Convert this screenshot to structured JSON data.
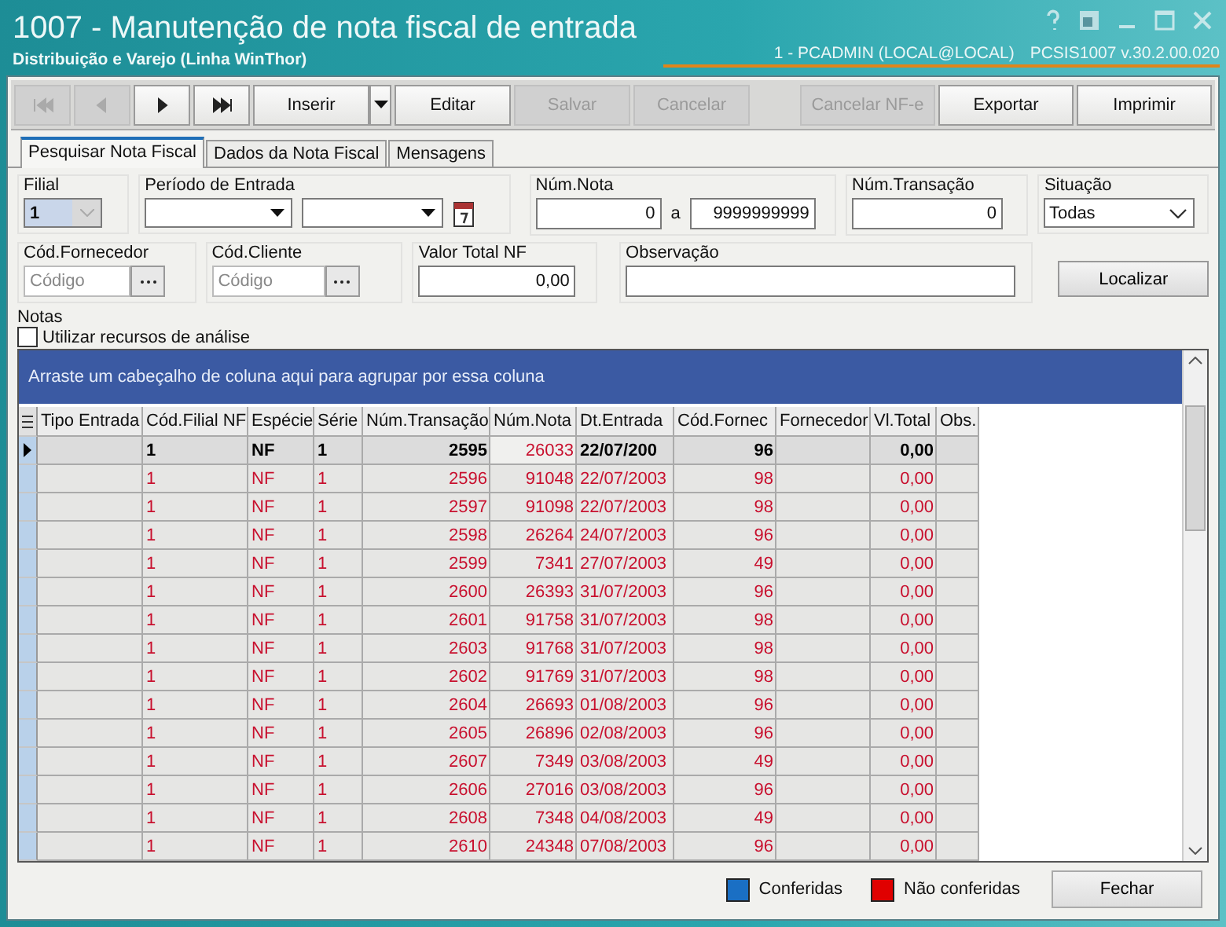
{
  "window": {
    "title": "1007 - Manutenção de nota fiscal de entrada",
    "subtitle": "Distribuição e Varejo (Linha WinThor)",
    "session": "1 - PCADMIN (LOCAL@LOCAL)",
    "version": "PCSIS1007  v.30.2.00.020"
  },
  "toolbar": {
    "nav": [
      {
        "disabled": true
      },
      {
        "disabled": true
      },
      {
        "disabled": false
      },
      {
        "disabled": false
      }
    ],
    "left": [
      {
        "label": "Inserir",
        "kind": "split",
        "disabled": false
      },
      {
        "label": "Editar",
        "kind": "plain",
        "disabled": false
      },
      {
        "label": "Salvar",
        "kind": "plain",
        "disabled": true
      },
      {
        "label": "Cancelar",
        "kind": "plain",
        "disabled": true
      }
    ],
    "right": [
      {
        "label": "Cancelar NF-e",
        "disabled": true
      },
      {
        "label": "Exportar",
        "disabled": false
      },
      {
        "label": "Imprimir",
        "disabled": false
      }
    ]
  },
  "tabs": [
    {
      "label": "Pesquisar Nota Fiscal",
      "selected": true
    },
    {
      "label": "Dados da Nota Fiscal",
      "selected": false
    },
    {
      "label": "Mensagens",
      "selected": false
    }
  ],
  "form": {
    "filial": {
      "label": "Filial",
      "value": "1"
    },
    "periodo": {
      "label": "Período de Entrada"
    },
    "num_nota": {
      "label": "Núm.Nota",
      "from": "0",
      "separator": "a",
      "to": "9999999999"
    },
    "num_transacao": {
      "label": "Núm.Transação",
      "value": "0"
    },
    "situacao": {
      "label": "Situação",
      "value": "Todas"
    },
    "cod_fornecedor": {
      "label": "Cód.Fornecedor",
      "placeholder": "Código"
    },
    "cod_cliente": {
      "label": "Cód.Cliente",
      "placeholder": "Código"
    },
    "valor_total": {
      "label": "Valor Total NF",
      "value": "0,00"
    },
    "observacao": {
      "label": "Observação"
    },
    "localizar": "Localizar"
  },
  "notas": {
    "label": "Notas",
    "checkbox": {
      "label": "Utilizar recursos de análise",
      "checked": false
    }
  },
  "grid": {
    "group_hint": "Arraste um cabeçalho de coluna aqui para agrupar por essa coluna",
    "columns": [
      "Tipo Entrada",
      "Cód.Filial NF",
      "Espécie",
      "Série",
      "Núm.Transação",
      "Núm.Nota",
      "Dt.Entrada",
      "Cód.Fornec",
      "Fornecedor",
      "Vl.Total",
      "Obs."
    ],
    "rows": [
      {
        "selected": true,
        "cells": [
          "",
          "1",
          "NF",
          "1",
          "2595",
          "26033",
          "22/07/200",
          "96",
          "",
          "0,00",
          ""
        ]
      },
      {
        "selected": false,
        "cells": [
          "",
          "1",
          "NF",
          "1",
          "2596",
          "91048",
          "22/07/2003",
          "98",
          "",
          "0,00",
          ""
        ]
      },
      {
        "selected": false,
        "cells": [
          "",
          "1",
          "NF",
          "1",
          "2597",
          "91098",
          "22/07/2003",
          "98",
          "",
          "0,00",
          ""
        ]
      },
      {
        "selected": false,
        "cells": [
          "",
          "1",
          "NF",
          "1",
          "2598",
          "26264",
          "24/07/2003",
          "96",
          "",
          "0,00",
          ""
        ]
      },
      {
        "selected": false,
        "cells": [
          "",
          "1",
          "NF",
          "1",
          "2599",
          "7341",
          "27/07/2003",
          "49",
          "",
          "0,00",
          ""
        ]
      },
      {
        "selected": false,
        "cells": [
          "",
          "1",
          "NF",
          "1",
          "2600",
          "26393",
          "31/07/2003",
          "96",
          "",
          "0,00",
          ""
        ]
      },
      {
        "selected": false,
        "cells": [
          "",
          "1",
          "NF",
          "1",
          "2601",
          "91758",
          "31/07/2003",
          "98",
          "",
          "0,00",
          ""
        ]
      },
      {
        "selected": false,
        "cells": [
          "",
          "1",
          "NF",
          "1",
          "2603",
          "91768",
          "31/07/2003",
          "98",
          "",
          "0,00",
          ""
        ]
      },
      {
        "selected": false,
        "cells": [
          "",
          "1",
          "NF",
          "1",
          "2602",
          "91769",
          "31/07/2003",
          "98",
          "",
          "0,00",
          ""
        ]
      },
      {
        "selected": false,
        "cells": [
          "",
          "1",
          "NF",
          "1",
          "2604",
          "26693",
          "01/08/2003",
          "96",
          "",
          "0,00",
          ""
        ]
      },
      {
        "selected": false,
        "cells": [
          "",
          "1",
          "NF",
          "1",
          "2605",
          "26896",
          "02/08/2003",
          "96",
          "",
          "0,00",
          ""
        ]
      },
      {
        "selected": false,
        "cells": [
          "",
          "1",
          "NF",
          "1",
          "2607",
          "7349",
          "03/08/2003",
          "49",
          "",
          "0,00",
          ""
        ]
      },
      {
        "selected": false,
        "cells": [
          "",
          "1",
          "NF",
          "1",
          "2606",
          "27016",
          "03/08/2003",
          "96",
          "",
          "0,00",
          ""
        ]
      },
      {
        "selected": false,
        "cells": [
          "",
          "1",
          "NF",
          "1",
          "2608",
          "7348",
          "04/08/2003",
          "49",
          "",
          "0,00",
          ""
        ]
      },
      {
        "selected": false,
        "cells": [
          "",
          "1",
          "NF",
          "1",
          "2610",
          "24348",
          "07/08/2003",
          "96",
          "",
          "0,00",
          ""
        ]
      }
    ]
  },
  "legend": [
    {
      "label": "Conferidas",
      "color": "#1a6fc4"
    },
    {
      "label": "Não conferidas",
      "color": "#e00000"
    }
  ],
  "close_button": "Fechar"
}
